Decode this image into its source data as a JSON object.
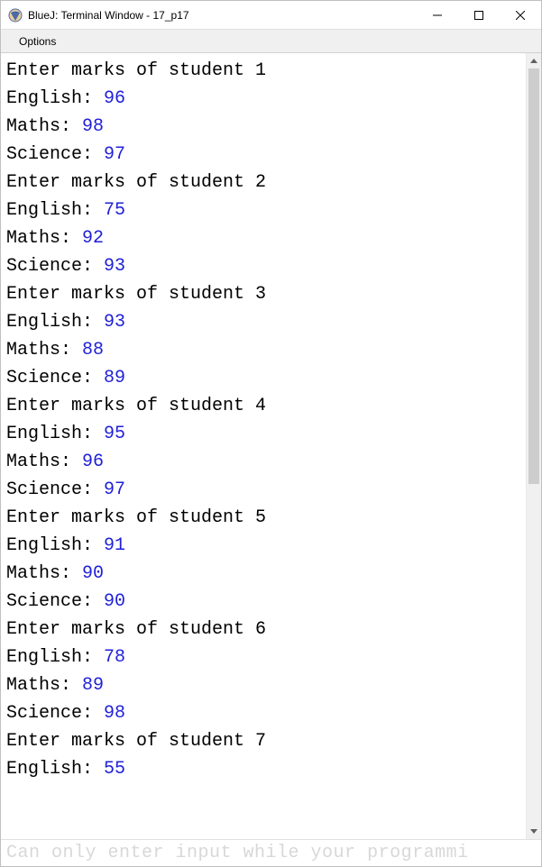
{
  "window": {
    "title": "BlueJ: Terminal Window - 17_p17"
  },
  "menu": {
    "options": "Options"
  },
  "terminal": {
    "lines": [
      {
        "prompt": "Enter marks of student 1",
        "value": null
      },
      {
        "prompt": "English: ",
        "value": "96"
      },
      {
        "prompt": "Maths: ",
        "value": "98"
      },
      {
        "prompt": "Science: ",
        "value": "97"
      },
      {
        "prompt": "Enter marks of student 2",
        "value": null
      },
      {
        "prompt": "English: ",
        "value": "75"
      },
      {
        "prompt": "Maths: ",
        "value": "92"
      },
      {
        "prompt": "Science: ",
        "value": "93"
      },
      {
        "prompt": "Enter marks of student 3",
        "value": null
      },
      {
        "prompt": "English: ",
        "value": "93"
      },
      {
        "prompt": "Maths: ",
        "value": "88"
      },
      {
        "prompt": "Science: ",
        "value": "89"
      },
      {
        "prompt": "Enter marks of student 4",
        "value": null
      },
      {
        "prompt": "English: ",
        "value": "95"
      },
      {
        "prompt": "Maths: ",
        "value": "96"
      },
      {
        "prompt": "Science: ",
        "value": "97"
      },
      {
        "prompt": "Enter marks of student 5",
        "value": null
      },
      {
        "prompt": "English: ",
        "value": "91"
      },
      {
        "prompt": "Maths: ",
        "value": "90"
      },
      {
        "prompt": "Science: ",
        "value": "90"
      },
      {
        "prompt": "Enter marks of student 6",
        "value": null
      },
      {
        "prompt": "English: ",
        "value": "78"
      },
      {
        "prompt": "Maths: ",
        "value": "89"
      },
      {
        "prompt": "Science: ",
        "value": "98"
      },
      {
        "prompt": "Enter marks of student 7",
        "value": null
      },
      {
        "prompt": "English: ",
        "value": "55"
      }
    ],
    "status": "Can only enter input while your programmi"
  }
}
